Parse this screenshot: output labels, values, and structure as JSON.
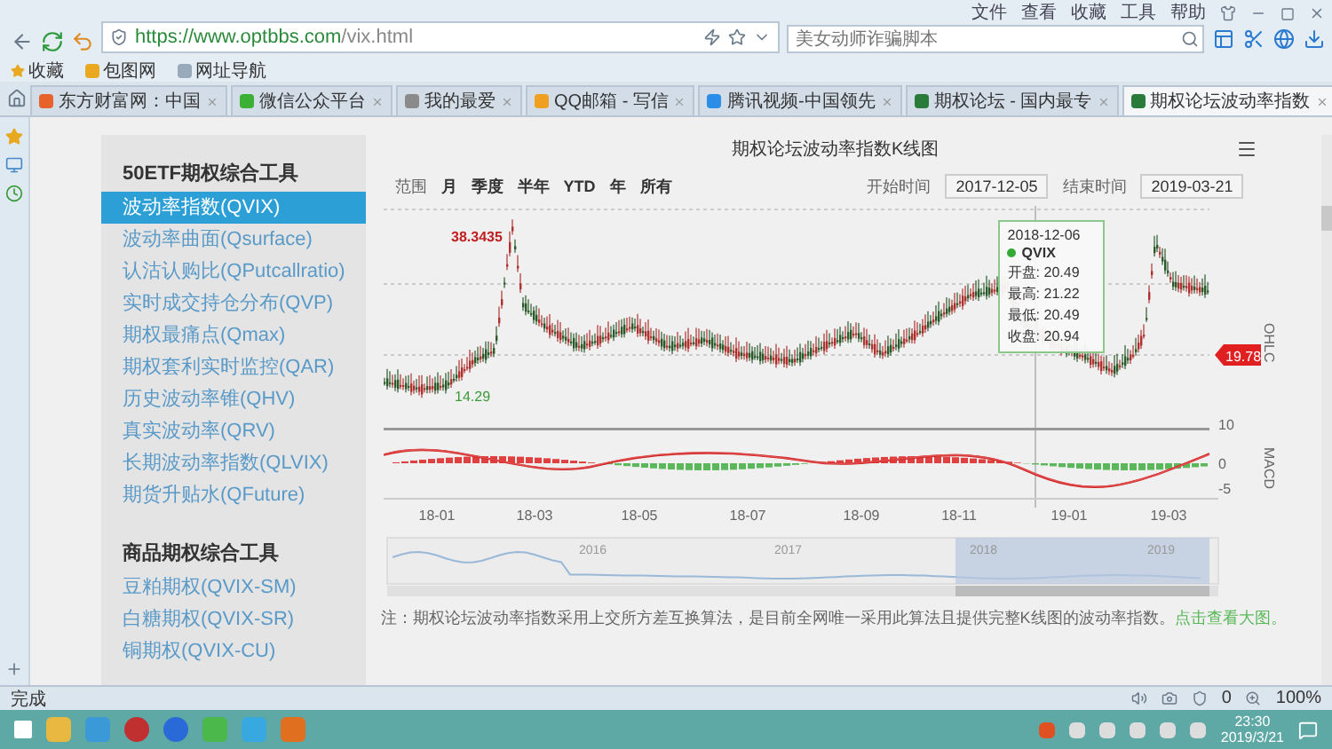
{
  "browser": {
    "menu": [
      "文件",
      "查看",
      "收藏",
      "工具",
      "帮助"
    ],
    "url_host": "https://www.optbbs.com",
    "url_path": "/vix.html",
    "search_placeholder": "美女动师诈骗脚本",
    "bookmarks": [
      "收藏",
      "包图网",
      "网址导航"
    ],
    "tabs": [
      {
        "label": "东方财富网：中国",
        "selected": false,
        "color": "#e8622c"
      },
      {
        "label": "微信公众平台",
        "selected": false,
        "color": "#3cb034"
      },
      {
        "label": "我的最爱",
        "selected": false,
        "color": "#8a8a8a"
      },
      {
        "label": "QQ邮箱 - 写信",
        "selected": false,
        "color": "#f0a020"
      },
      {
        "label": "腾讯视频-中国领先",
        "selected": false,
        "color": "#2a8ee8"
      },
      {
        "label": "期权论坛 - 国内最专",
        "selected": false,
        "color": "#2a7a3a"
      },
      {
        "label": "期权论坛波动率指数",
        "selected": true,
        "color": "#2a7a3a"
      }
    ],
    "status": "完成",
    "shield_count": "0",
    "zoom": "100%"
  },
  "sidebar": [
    {
      "title": "50ETF期权综合工具",
      "items": [
        {
          "label": "波动率指数(QVIX)",
          "selected": true
        },
        {
          "label": "波动率曲面(Qsurface)",
          "selected": false
        },
        {
          "label": "认沽认购比(QPutcallratio)",
          "selected": false
        },
        {
          "label": "实时成交持仓分布(QVP)",
          "selected": false
        },
        {
          "label": "期权最痛点(Qmax)",
          "selected": false
        },
        {
          "label": "期权套利实时监控(QAR)",
          "selected": false
        },
        {
          "label": "历史波动率锥(QHV)",
          "selected": false
        },
        {
          "label": "真实波动率(QRV)",
          "selected": false
        },
        {
          "label": "长期波动率指数(QLVIX)",
          "selected": false
        },
        {
          "label": "期货升贴水(QFuture)",
          "selected": false
        }
      ]
    },
    {
      "title": "商品期权综合工具",
      "items": [
        {
          "label": "豆粕期权(QVIX-SM)",
          "selected": false
        },
        {
          "label": "白糖期权(QVIX-SR)",
          "selected": false
        },
        {
          "label": "铜期权(QVIX-CU)",
          "selected": false
        }
      ]
    }
  ],
  "chart": {
    "title": "期权论坛波动率指数K线图",
    "range_label": "范围",
    "ranges": [
      "月",
      "季度",
      "半年",
      "YTD",
      "年",
      "所有"
    ],
    "start_label": "开始时间",
    "start_date": "2017-12-05",
    "end_label": "结束时间",
    "end_date": "2019-03-21",
    "peak_label": "38.3435",
    "low_label": "14.29",
    "last_label": "19.78",
    "price_axis": "OHLC",
    "macd_axis": "MACD",
    "macd_ticks": [
      "10",
      "0",
      "-5"
    ],
    "x_labels": [
      "18-01",
      "18-03",
      "18-05",
      "18-07",
      "18-09",
      "18-11",
      "19-01",
      "19-03"
    ],
    "navigator_years": [
      "2016",
      "2017",
      "2018",
      "2019"
    ],
    "tooltip": {
      "date": "2018-12-06",
      "series": "QVIX",
      "rows": [
        "开盘: 20.49",
        "最高: 21.22",
        "最低: 20.49",
        "收盘: 20.94"
      ]
    },
    "note": "注：期权论坛波动率指数采用上交所方差互换算法，是目前全网唯一采用此算法且提供完整K线图的波动率指数。",
    "note_link": "点击查看大图。"
  },
  "taskbar": {
    "time": "23:30",
    "date": "2019/3/21"
  }
}
